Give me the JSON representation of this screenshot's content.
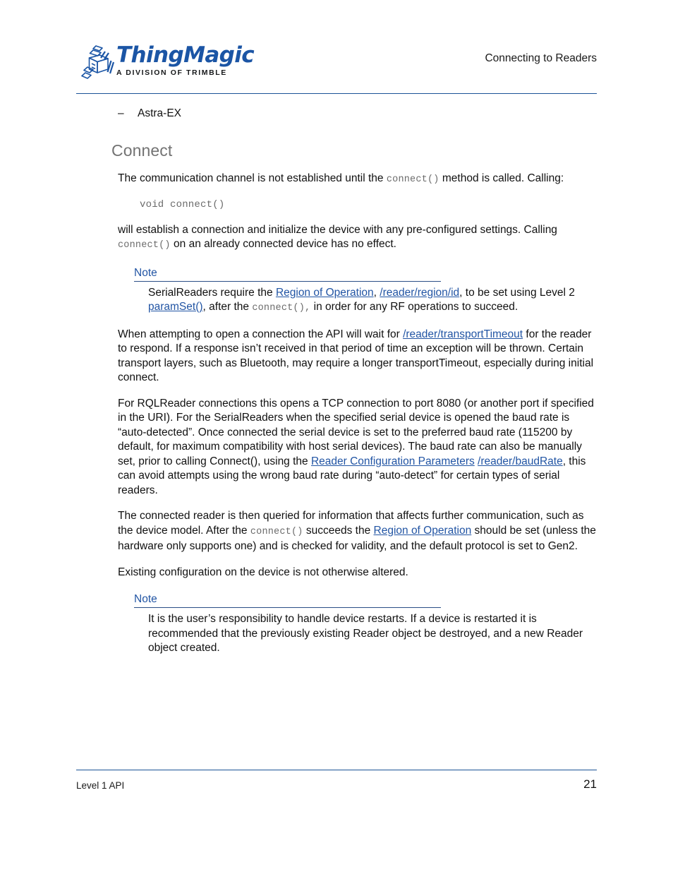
{
  "header": {
    "logo_wordmark": "ThingMagic",
    "logo_tagline": "A DIVISION OF TRIMBLE",
    "logo_icon_name": "thingmagic-cube-logo",
    "title": "Connecting to Readers",
    "rule_color": "#1a5296"
  },
  "content": {
    "bullet": {
      "dash": "–",
      "label": "Astra-EX"
    },
    "section_title": "Connect",
    "para1": {
      "before_code": "The communication channel is not established until the ",
      "code": "connect()",
      "after_code": "  method is called. Calling:"
    },
    "code_block": "void connect()",
    "para2": {
      "line1": "will establish a connection and initialize the device with any pre-configured settings. Calling ",
      "code": "connect()",
      "line2": " on an already connected device has no effect."
    },
    "note1": {
      "label": "Note",
      "t1": "SerialReaders require the ",
      "link1": "Region of Operation",
      "t2": ", ",
      "link2": "/reader/region/id",
      "t3": ", to be set using Level 2 ",
      "link3": "paramSet()",
      "t4": ", after the ",
      "code": "connect(),",
      "t5": " in order for any RF operations to succeed."
    },
    "para3": {
      "t1": "When attempting to open a connection the API will wait for ",
      "link1": "/reader/transportTimeout",
      "t2": " for the reader to respond. If a response isn’t received in that period of time an exception will be thrown. Certain transport layers, such as Bluetooth, may require a longer transportTimeout, especially during initial connect."
    },
    "para4": {
      "t1": "For RQLReader connections this opens a TCP connection to port 8080 (or another port if specified in the URI). For the SerialReaders when the specified serial device is opened the baud rate is “auto-detected”. Once connected the serial device is set to the preferred baud rate (115200 by default, for maximum compatibility with host serial devices). The baud rate can also be manually set, prior to calling Connect(), using the ",
      "link1": "Reader Configuration Parameters",
      "t2": " ",
      "link2": "/reader/baudRate",
      "t3": ", this can avoid attempts using the wrong baud rate during “auto-detect” for certain types of serial readers."
    },
    "para5": {
      "t1": "The connected reader is then queried for information that affects further communication, such as the device model. After the ",
      "code": "connect()",
      "t2": "  succeeds the ",
      "link1": "Region of Operation",
      "t3": " should be set (unless the hardware only supports one) and is checked for validity, and the default protocol is set to Gen2."
    },
    "para6": "Existing configuration on the device is not otherwise altered.",
    "note2": {
      "label": "Note",
      "text": "It is the user’s responsibility to handle device restarts. If a device is restarted it is recommended that the previously existing Reader object be destroyed, and a new Reader object created."
    }
  },
  "footer": {
    "left": "Level 1 API",
    "page_number": "21",
    "rule_color": "#1a5296"
  }
}
